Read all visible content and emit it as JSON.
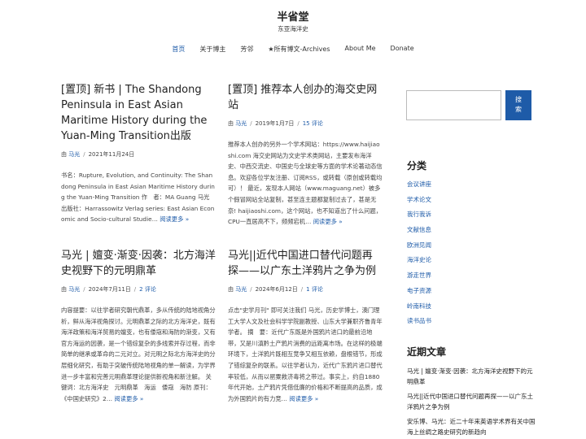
{
  "site": {
    "title": "半省堂",
    "tagline": "东亚海洋史"
  },
  "nav": [
    "首页",
    "关于博主",
    "芳邻",
    "★所有博文-Archives",
    "About Me",
    "Donate"
  ],
  "posts": [
    {
      "title": "[置顶] 新书 | The Shandong Peninsula in East Asian Maritime History during the Yuan-Ming Transition出版",
      "by": "由",
      "author": "马光",
      "date": "2021年11月24日",
      "comments": "",
      "excerpt": "书名：Rupture, Evolution, and Continuity: The Shandong Peninsula in East Asian Maritime History during the Yuan-Ming Transition 作　者：MA Guang 马光 出版社：Harrassowitz Verlag series: East Asian Economic and Socio-cultural Studie…",
      "more": "阅读更多 »"
    },
    {
      "title": "[置顶] 推荐本人创办的海交史网站",
      "by": "由",
      "author": "马光",
      "date": "2019年1月7日",
      "comments": "15 评论",
      "excerpt": "推荐本人创办的另外一个学术网站：https://www.haijiaoshi.com 海交史网站为文史学术类网站，主要发布海洋史、中西交流史、中国史与全球史等方面的学术论著动态信息。欢迎各位学友注册、订阅RSS，或转载（原创或转载均可）！ 最近，发现本人网站（www.maguang.net）被多个假冒网站全站复制，甚至连主题都复制过去了，甚是无奈! haijiaoshi.com，这个网站，也不知道出了什么问题，CPU一直居高不下，频频宕机…",
      "more": "阅读更多 »"
    },
    {
      "title": "马光 | 嬗变·渐变·因袭：北方海洋史视野下的元明鼎革",
      "by": "由",
      "author": "马光",
      "date": "2024年7月11日",
      "comments": "2 评论",
      "excerpt": "内容提要：以往学者研究朝代鼎革，多从传统的陆地视角分析，鲜从海洋视角探讨。元明鼎革之际的北方海洋史，既有海洋政策和海洋贸易的嬗变，也有倭寇和海防的渐变，又有官方海运的因袭，是一个错综复杂的多线索并存过程，而非简单的继承或革命的二元对立。对元明之际北方海洋史的分层细化研究，有助于突破传统陆地视角的单一解读，为学界进一步丰富和完善元明鼎革理论提供新视角和新注解。 关键词：北方海洋史　元明鼎革　海运　倭寇　海防 原刊：《中国史研究》2…",
      "more": "阅读更多 »"
    },
    {
      "title": "马光||近代中国进口替代问题再探——以广东土洋鸦片之争为例",
      "by": "由",
      "author": "马光",
      "date": "2024年6月12日",
      "comments": "1 评论",
      "excerpt": "点击\"史学月刊\" 即可关注我们 马光，历史学博士，澳门理工大学人文及社会科学学院副教授、山东大学兼职齐鲁青年学者。 摘　要：近代广东既是外国鸦片进口的最前沿地带，又是川滇黔土产鸦片消费的远距离市场。在这样的极端环境下，土洋鸦片既相互竞争又相互依赖，盘根错节，形成了错综复杂的联系。以往学者认为，近代广东鸦片进口替代率较低，从而以罂粟救济毒将之带过。事实上，约自1880年代开始，土产鸦片凭借低廉的价格和不断提高的品质，成为外国鸦片的有力竞…",
      "more": "阅读更多 »"
    }
  ],
  "sidebar": {
    "search_button": "搜索",
    "categories_title": "分类",
    "categories": [
      "会议讲座",
      "学术论文",
      "我行我诉",
      "文献信息",
      "欧洲见闻",
      "海洋史论",
      "游走世界",
      "电子资源",
      "岭南科技",
      "读书品书"
    ],
    "recent_title": "近期文章",
    "recent": [
      "马光 | 嬗变·渐变·因袭：北方海洋史视野下的元明鼎革",
      "马光||近代中国进口替代问题再探——以广东土洋鸦片之争为例",
      "安乐博、马光：近二十年来英语学术界有关中国海上丝绸之路史研究的新趋向"
    ]
  },
  "colors": {
    "link": "#1e5ba8",
    "button": "#1e5ba8"
  }
}
